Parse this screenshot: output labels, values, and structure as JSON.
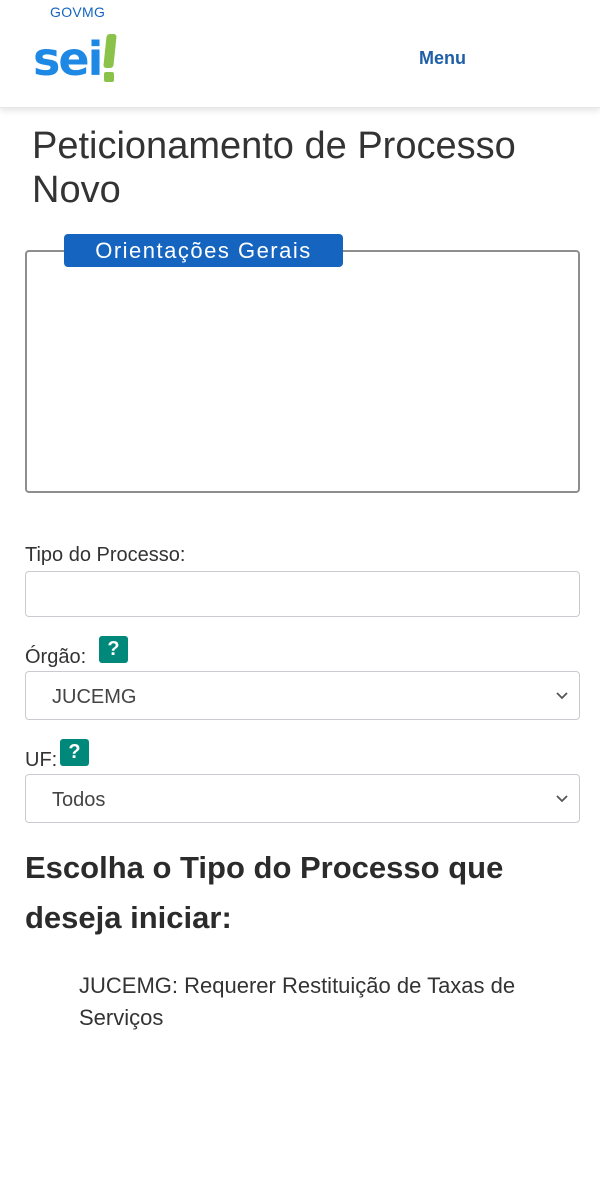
{
  "header": {
    "govmg": "GOVMG",
    "logo_text": "sei",
    "menu_label": "Menu"
  },
  "page": {
    "title": "Peticionamento de Processo Novo"
  },
  "orientacoes": {
    "legend": "Orientações Gerais"
  },
  "form": {
    "tipo_label": "Tipo do Processo:",
    "tipo_value": "",
    "orgao_label": "Órgão:",
    "orgao_value": "JUCEMG",
    "uf_label": "UF:",
    "uf_value": "Todos",
    "help_symbol": "?"
  },
  "choose": {
    "heading": "Escolha o Tipo do Processo que deseja iniciar:",
    "options": [
      "JUCEMG: Requerer Restituição de Taxas de Serviços"
    ]
  },
  "colors": {
    "brand_blue": "#1565c0",
    "logo_blue": "#1e88e5",
    "logo_green": "#8bc34a",
    "help_teal": "#00897b"
  },
  "icons": {
    "help": "question-mark-icon",
    "select_arrow": "chevron-down-icon"
  }
}
